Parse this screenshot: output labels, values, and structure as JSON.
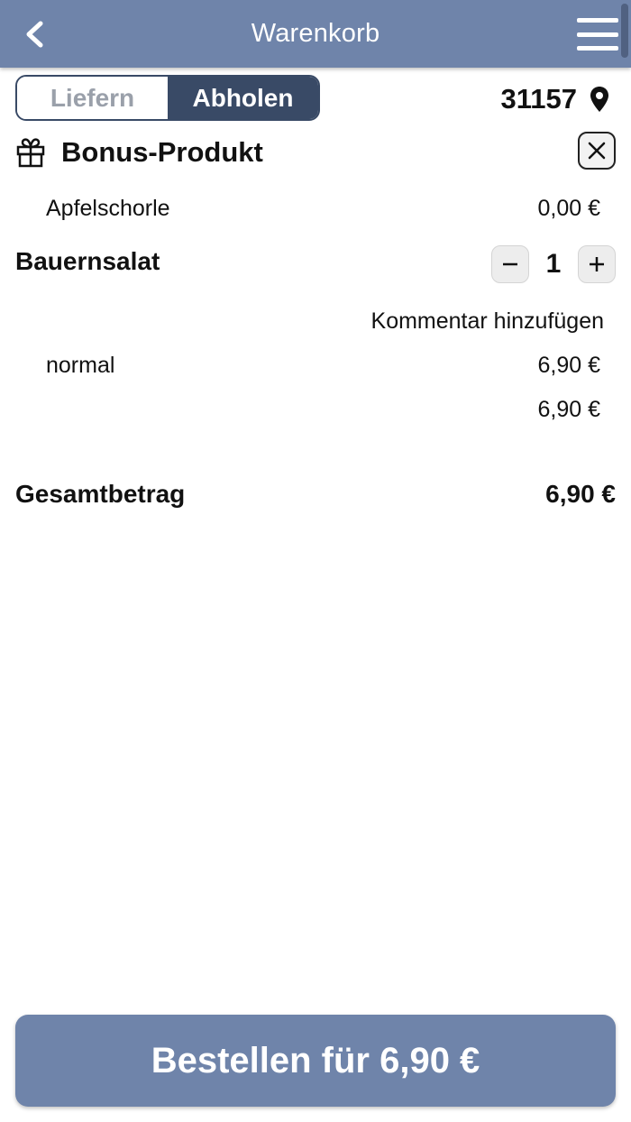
{
  "theme": {
    "primary": "#6f84aa",
    "dark": "#394a66"
  },
  "header": {
    "title": "Warenkorb",
    "back_icon": "chevron-left-icon",
    "menu_icon": "hamburger-menu-icon"
  },
  "mode_toggle": {
    "options": [
      "Liefern",
      "Abholen"
    ],
    "selected": "Abholen"
  },
  "location": {
    "zip": "31157",
    "icon": "location-pin-icon"
  },
  "bonus": {
    "icon": "gift-icon",
    "title": "Bonus-Produkt",
    "item_name": "Apfelschorle",
    "item_price": "0,00 €"
  },
  "cart": {
    "items": [
      {
        "name": "Bauernsalat",
        "quantity": "1",
        "comment_link": "Kommentar hinzufügen",
        "variant": "normal",
        "variant_price": "6,90 €",
        "subtotal": "6,90 €"
      }
    ]
  },
  "summary": {
    "total_label": "Gesamtbetrag",
    "total_value": "6,90 €"
  },
  "order_button": {
    "label": "Bestellen für 6,90 €"
  }
}
